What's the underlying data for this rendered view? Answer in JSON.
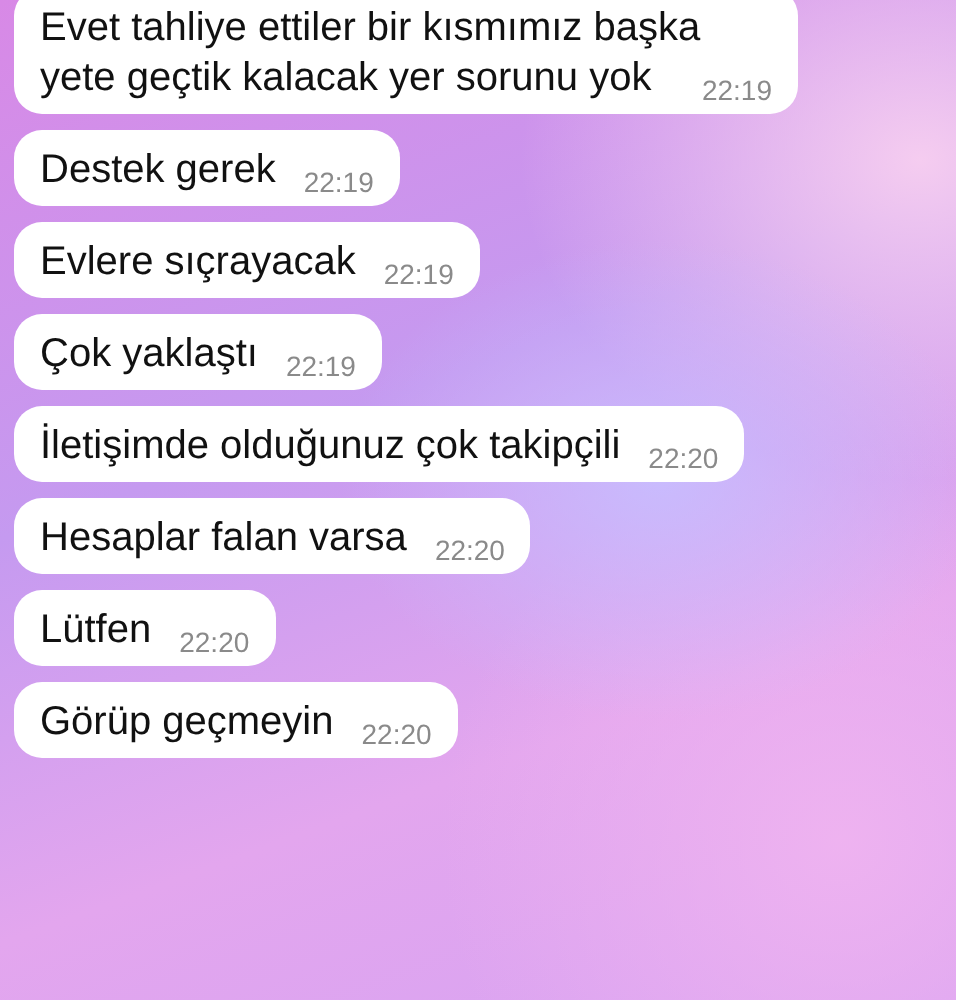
{
  "messages": [
    {
      "text": "Evet tahliye ettiler bir kısmımız başka yete geçtik kalacak yer sorunu yok",
      "time": "22:19"
    },
    {
      "text": "Destek gerek",
      "time": "22:19"
    },
    {
      "text": "Evlere sıçrayacak",
      "time": "22:19"
    },
    {
      "text": "Çok yaklaştı",
      "time": "22:19"
    },
    {
      "text": "İletişimde olduğunuz çok takipçili",
      "time": "22:20"
    },
    {
      "text": "Hesaplar falan varsa",
      "time": "22:20"
    },
    {
      "text": "Lütfen",
      "time": "22:20"
    },
    {
      "text": "Görüp geçmeyin",
      "time": "22:20"
    }
  ]
}
